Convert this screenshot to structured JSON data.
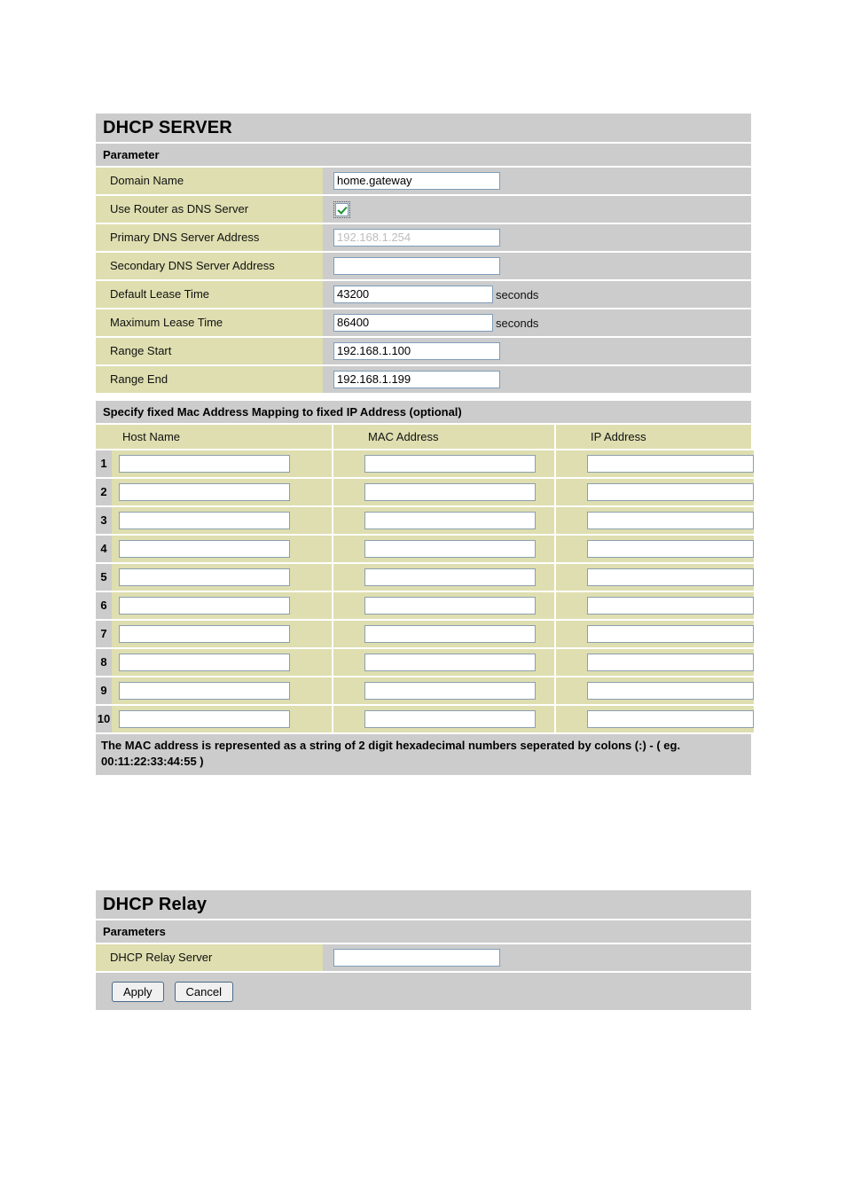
{
  "dhcp_server": {
    "title": "DHCP SERVER",
    "subtitle": "Parameter",
    "rows": [
      {
        "label": "Domain Name",
        "value": "home.gateway",
        "unit": ""
      },
      {
        "label": "Use Router as DNS Server",
        "value": "",
        "unit": ""
      },
      {
        "label": "Primary DNS Server Address",
        "value": "",
        "placeholder": "192.168.1.254",
        "unit": ""
      },
      {
        "label": "Secondary DNS Server Address",
        "value": "",
        "unit": ""
      },
      {
        "label": "Default Lease Time",
        "value": "43200",
        "unit": "seconds"
      },
      {
        "label": "Maximum Lease Time",
        "value": "86400",
        "unit": "seconds"
      },
      {
        "label": "Range Start",
        "value": "192.168.1.100",
        "unit": ""
      },
      {
        "label": "Range End",
        "value": "192.168.1.199",
        "unit": ""
      }
    ],
    "use_router_as_dns_checked": true
  },
  "mapping": {
    "title": "Specify fixed Mac Address Mapping to fixed IP Address (optional)",
    "columns": [
      "Host Name",
      "MAC Address",
      "IP Address"
    ],
    "rows": [
      {
        "num": "1",
        "host": "",
        "mac": "",
        "ip": ""
      },
      {
        "num": "2",
        "host": "",
        "mac": "",
        "ip": ""
      },
      {
        "num": "3",
        "host": "",
        "mac": "",
        "ip": ""
      },
      {
        "num": "4",
        "host": "",
        "mac": "",
        "ip": ""
      },
      {
        "num": "5",
        "host": "",
        "mac": "",
        "ip": ""
      },
      {
        "num": "6",
        "host": "",
        "mac": "",
        "ip": ""
      },
      {
        "num": "7",
        "host": "",
        "mac": "",
        "ip": ""
      },
      {
        "num": "8",
        "host": "",
        "mac": "",
        "ip": ""
      },
      {
        "num": "9",
        "host": "",
        "mac": "",
        "ip": ""
      },
      {
        "num": "10",
        "host": "",
        "mac": "",
        "ip": ""
      }
    ],
    "note": "The MAC address is represented as a string of 2 digit hexadecimal numbers seperated by colons (:) - ( eg. 00:11:22:33:44:55 )"
  },
  "dhcp_relay": {
    "title": "DHCP Relay",
    "subtitle": "Parameters",
    "rows": [
      {
        "label": "DHCP Relay Server",
        "value": ""
      }
    ],
    "apply_label": "Apply",
    "cancel_label": "Cancel"
  },
  "colors": {
    "header_gray": "#cccccc",
    "label_khaki": "#dedeb0",
    "input_border": "#7f9db9",
    "check_green": "#1a9334",
    "page_bg": "#ffffff"
  }
}
